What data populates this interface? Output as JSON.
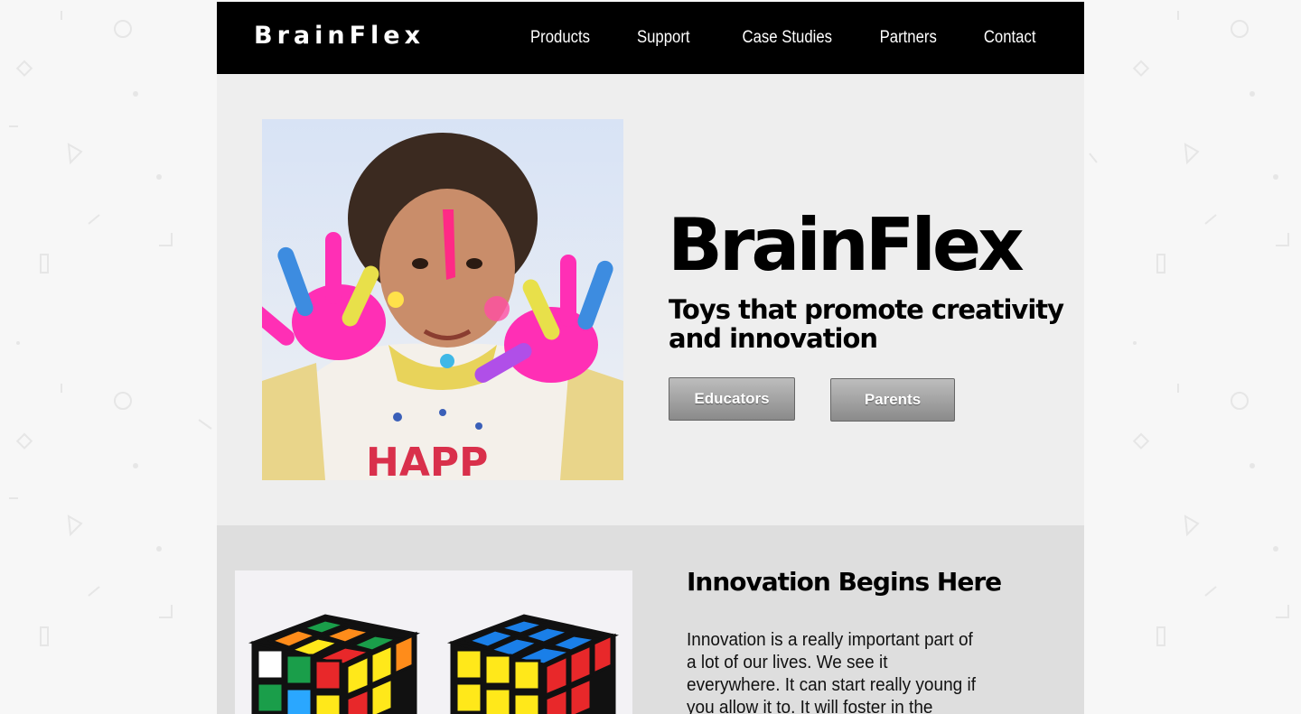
{
  "brand": {
    "logo": "BrainFlex"
  },
  "nav": {
    "items": [
      {
        "label": "Products"
      },
      {
        "label": "Support"
      },
      {
        "label": "Case Studies"
      },
      {
        "label": "Partners"
      },
      {
        "label": "Contact"
      }
    ]
  },
  "hero": {
    "title": "BrainFlex",
    "subtitle": "Toys that promote creativity and innovation",
    "buttons": [
      {
        "label": "Educators"
      },
      {
        "label": "Parents"
      }
    ],
    "image_icon": "child-painted-hands-photo"
  },
  "innovation": {
    "title": "Innovation Begins Here",
    "body": "Innovation is a really important part of a lot of our lives. We see it everywhere. It can start really young if you allow it to. It will foster in the minds of young",
    "image_icon": "rubiks-cubes-photo"
  },
  "colors": {
    "navbar": "#000000",
    "hero_bg": "#eeeeee",
    "section_bg": "#dedede",
    "page_bg": "#f7f7f7"
  }
}
